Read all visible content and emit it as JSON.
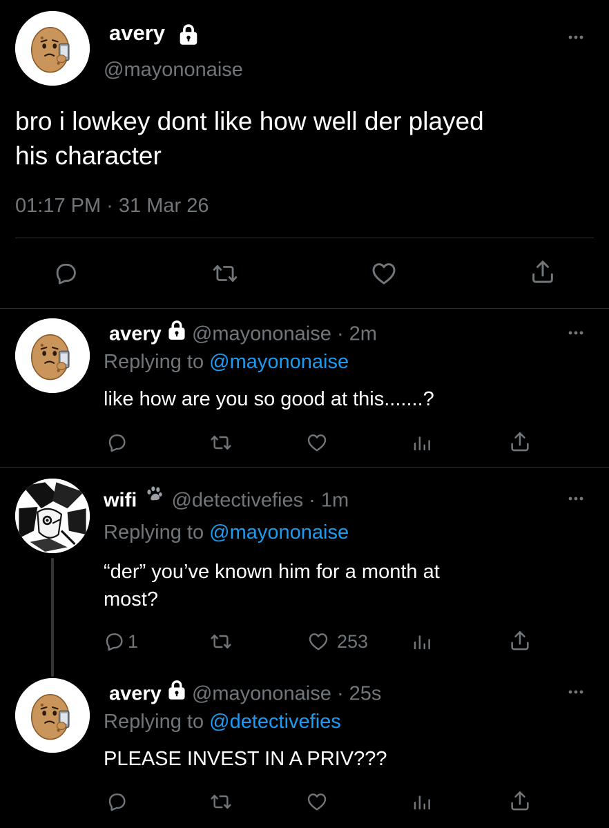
{
  "main_tweet": {
    "display_name": "avery",
    "handle": "@mayononaise",
    "text_line1": "bro i lowkey dont like how well der played",
    "text_line2": "his character",
    "timestamp": "01:17 PM · 31 Mar 26"
  },
  "replies": [
    {
      "display_name": "avery",
      "handle": "@mayononaise",
      "time": "· 2m",
      "replying_prefix": "Replying to",
      "replying_to": "@mayononaise",
      "text_line1": "like how are you so good at this.......?",
      "text_line2": ""
    },
    {
      "display_name": "wifi",
      "handle": "@detectivefies",
      "time": "· 1m",
      "replying_prefix": "Replying to",
      "replying_to": "@mayononaise",
      "text_line1": "“der” you’ve known him for a month at",
      "text_line2": "most?",
      "reply_count": "1",
      "like_count": "253"
    },
    {
      "display_name": "avery",
      "handle": "@mayononaise",
      "time": "· 25s",
      "replying_prefix": "Replying to",
      "replying_to": "@detectivefies",
      "text_line1": "PLEASE INVEST IN A PRIV???",
      "text_line2": ""
    }
  ],
  "colors": {
    "background": "#000000",
    "text": "#ffffff",
    "muted": "#71767b",
    "link": "#1d9bf0",
    "divider": "#2f3336"
  }
}
